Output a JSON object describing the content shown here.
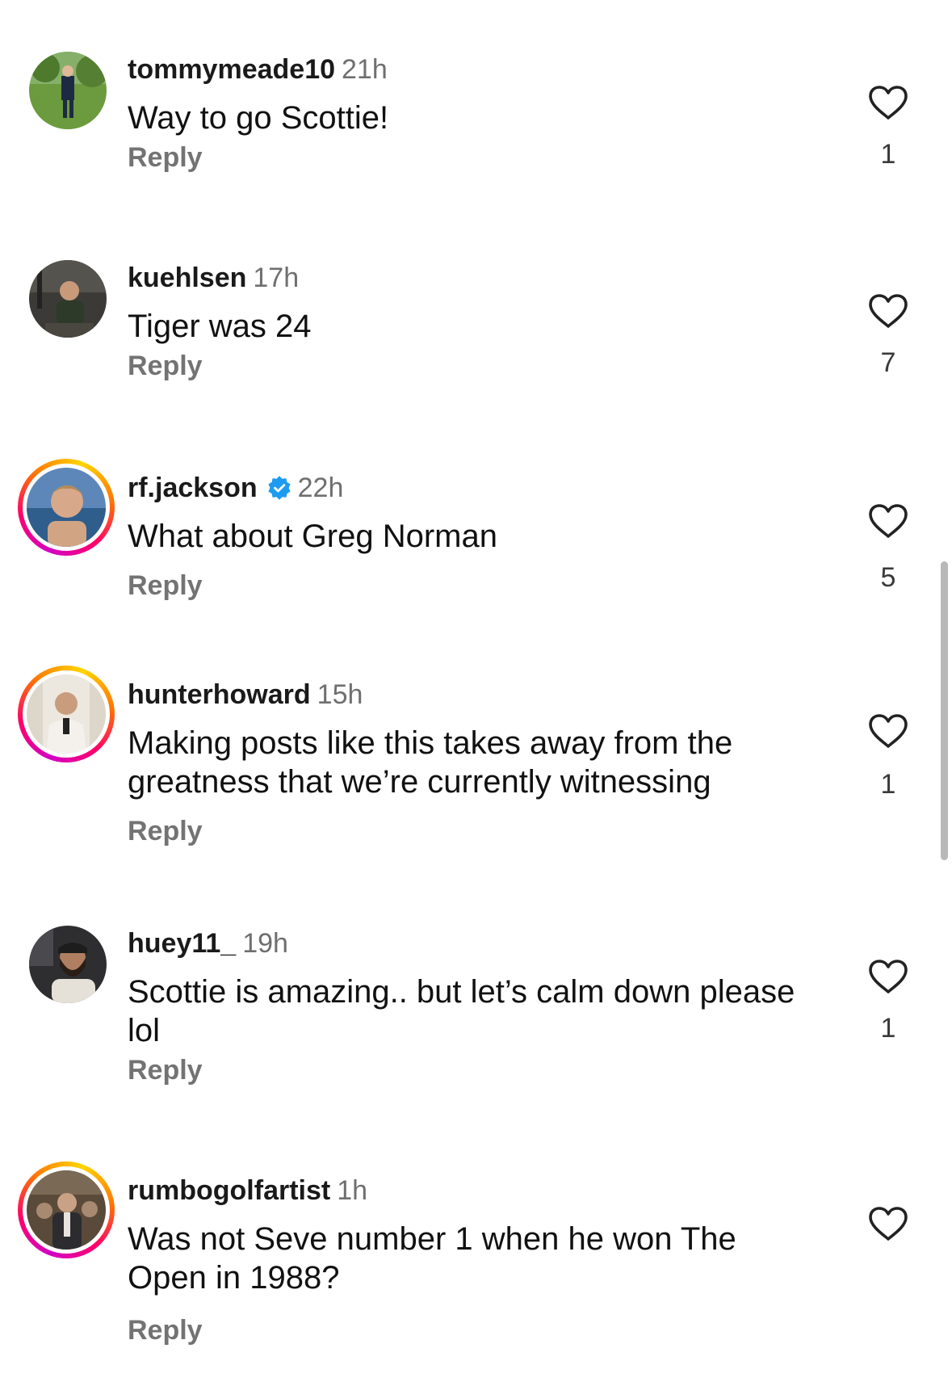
{
  "comments": [
    {
      "username": "tommymeade10",
      "time": "21h",
      "text": "Way to go Scottie!",
      "reply": "Reply",
      "likes": "1",
      "verified": false,
      "story_ring": false
    },
    {
      "username": "kuehlsen",
      "time": "17h",
      "text": "Tiger was 24",
      "reply": "Reply",
      "likes": "7",
      "verified": false,
      "story_ring": false
    },
    {
      "username": "rf.jackson",
      "time": "22h",
      "text": "What about Greg Norman",
      "reply": "Reply",
      "likes": "5",
      "verified": true,
      "story_ring": true
    },
    {
      "username": "hunterhoward",
      "time": "15h",
      "text": "Making posts like this takes away from the greatness that we’re currently witnessing",
      "reply": "Reply",
      "likes": "1",
      "verified": false,
      "story_ring": true
    },
    {
      "username": "huey11_",
      "time": "19h",
      "text": "Scottie is amazing.. but let’s calm down please lol",
      "reply": "Reply",
      "likes": "1",
      "verified": false,
      "story_ring": false
    },
    {
      "username": "rumbogolfartist",
      "time": "1h",
      "text": "Was not Seve number 1 when he won The Open in 1988?",
      "reply": "Reply",
      "likes": "",
      "verified": false,
      "story_ring": true
    }
  ],
  "icons": {
    "like": "heart-outline-icon",
    "verified": "verified-badge-icon"
  },
  "colors": {
    "verified_blue": "#1d9bf0",
    "meta_gray": "#737373",
    "story_ring": [
      "#d300c5",
      "#ff0069",
      "#ff7a00",
      "#ffd600"
    ]
  }
}
